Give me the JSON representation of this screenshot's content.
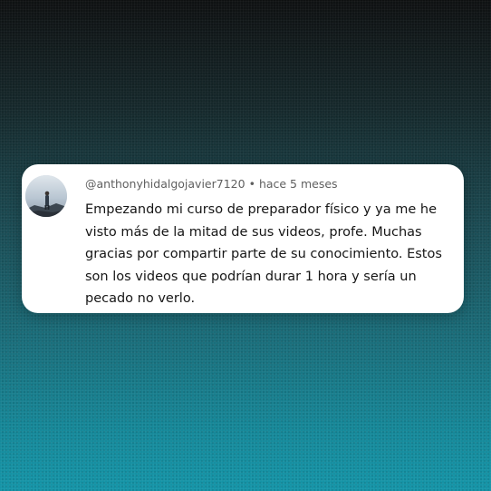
{
  "comment": {
    "username": "@anthonyhidalgojavier7120",
    "separator": "•",
    "time": "hace 5 meses",
    "text": "Empezando mi curso de preparador físico y ya me he visto más de la mitad de sus videos, profe. Muchas gracias por compartir parte de su conocimiento. Estos son los videos que podrían durar 1 hora y sería un pecado no verlo.",
    "avatar": "user-avatar-photo"
  },
  "colors": {
    "card_background": "#ffffff",
    "meta_text": "#5f5f5f",
    "body_text": "#161616",
    "background_top": "#0f1112",
    "background_bottom": "#1595a8"
  }
}
